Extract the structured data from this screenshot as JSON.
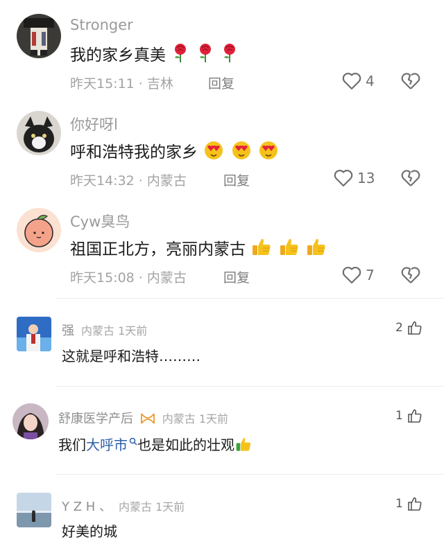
{
  "comments_top": [
    {
      "username": "Stronger",
      "text": "我的家乡真美",
      "emoji": [
        "rose-icon",
        "rose-icon",
        "rose-icon"
      ],
      "time": "昨天15:11",
      "location": "吉林",
      "reply": "回复",
      "likes": "4"
    },
    {
      "username": "你好呀l",
      "text": "呼和浩特我的家乡",
      "emoji": [
        "heart-eyes-icon",
        "heart-eyes-icon",
        "heart-eyes-icon"
      ],
      "time": "昨天14:32",
      "location": "内蒙古",
      "reply": "回复",
      "likes": "13"
    },
    {
      "username": "Cyw臭鸟",
      "text": "祖国正北方，亮丽内蒙古",
      "emoji": [
        "thumbs-up-icon",
        "thumbs-up-icon",
        "thumbs-up-icon"
      ],
      "time": "昨天15:08",
      "location": "内蒙古",
      "reply": "回复",
      "likes": "7"
    }
  ],
  "comments_bottom": [
    {
      "username": "强",
      "meta": "内蒙古 1天前",
      "text": "这就是呼和浩特………",
      "likes": "2"
    },
    {
      "username": "舒康医学产后",
      "meta": "内蒙古 1天前",
      "text_before": "我们",
      "link": "大呼市",
      "text_after": "也是如此的壮观",
      "likes": "1"
    },
    {
      "username": "Y Z H 、",
      "meta": "内蒙古 1天前",
      "text": "好美的城",
      "likes": "1"
    }
  ],
  "separator": " · ",
  "colors": {
    "username": "#9a9a9a",
    "link": "#2b5fa8",
    "rose": "#e0213a",
    "emoji_yellow": "#f5c21b"
  }
}
